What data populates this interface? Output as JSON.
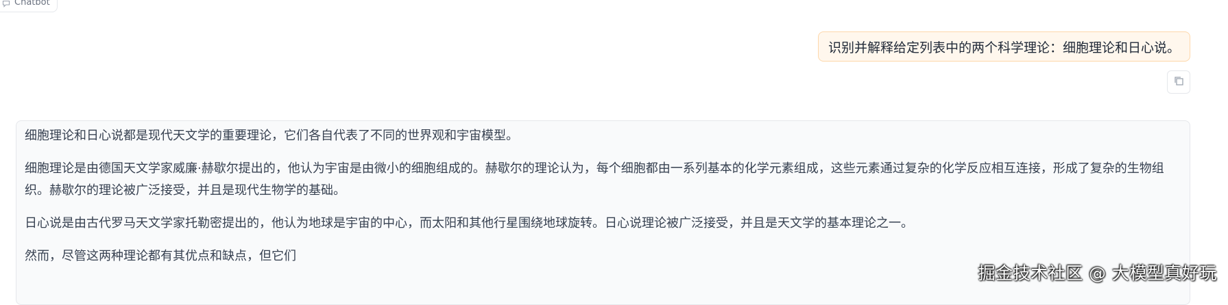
{
  "header": {
    "chatbot_label": "Chatbot"
  },
  "conversation": {
    "user_message": "识别并解释给定列表中的两个科学理论：细胞理论和日心说。",
    "bot_paragraphs": [
      "细胞理论和日心说都是现代天文学的重要理论，它们各自代表了不同的世界观和宇宙模型。",
      "细胞理论是由德国天文学家威廉·赫歇尔提出的，他认为宇宙是由微小的细胞组成的。赫歇尔的理论认为，每个细胞都由一系列基本的化学元素组成，这些元素通过复杂的化学反应相互连接，形成了复杂的生物组织。赫歇尔的理论被广泛接受，并且是现代生物学的基础。",
      "日心说是由古代罗马天文学家托勒密提出的，他认为地球是宇宙的中心，而太阳和其他行星围绕地球旋转。日心说理论被广泛接受，并且是天文学的基本理论之一。",
      "然而，尽管这两种理论都有其优点和缺点，但它们"
    ]
  },
  "watermark": "掘金技术社区 @ 大模型真好玩",
  "icons": {
    "chatbot": "chat-bubble-icon",
    "copy": "copy-icon"
  },
  "colors": {
    "user_bubble_bg": "#fff7ed",
    "user_bubble_border": "#fed7aa",
    "bot_bubble_bg": "#f9fafb"
  }
}
